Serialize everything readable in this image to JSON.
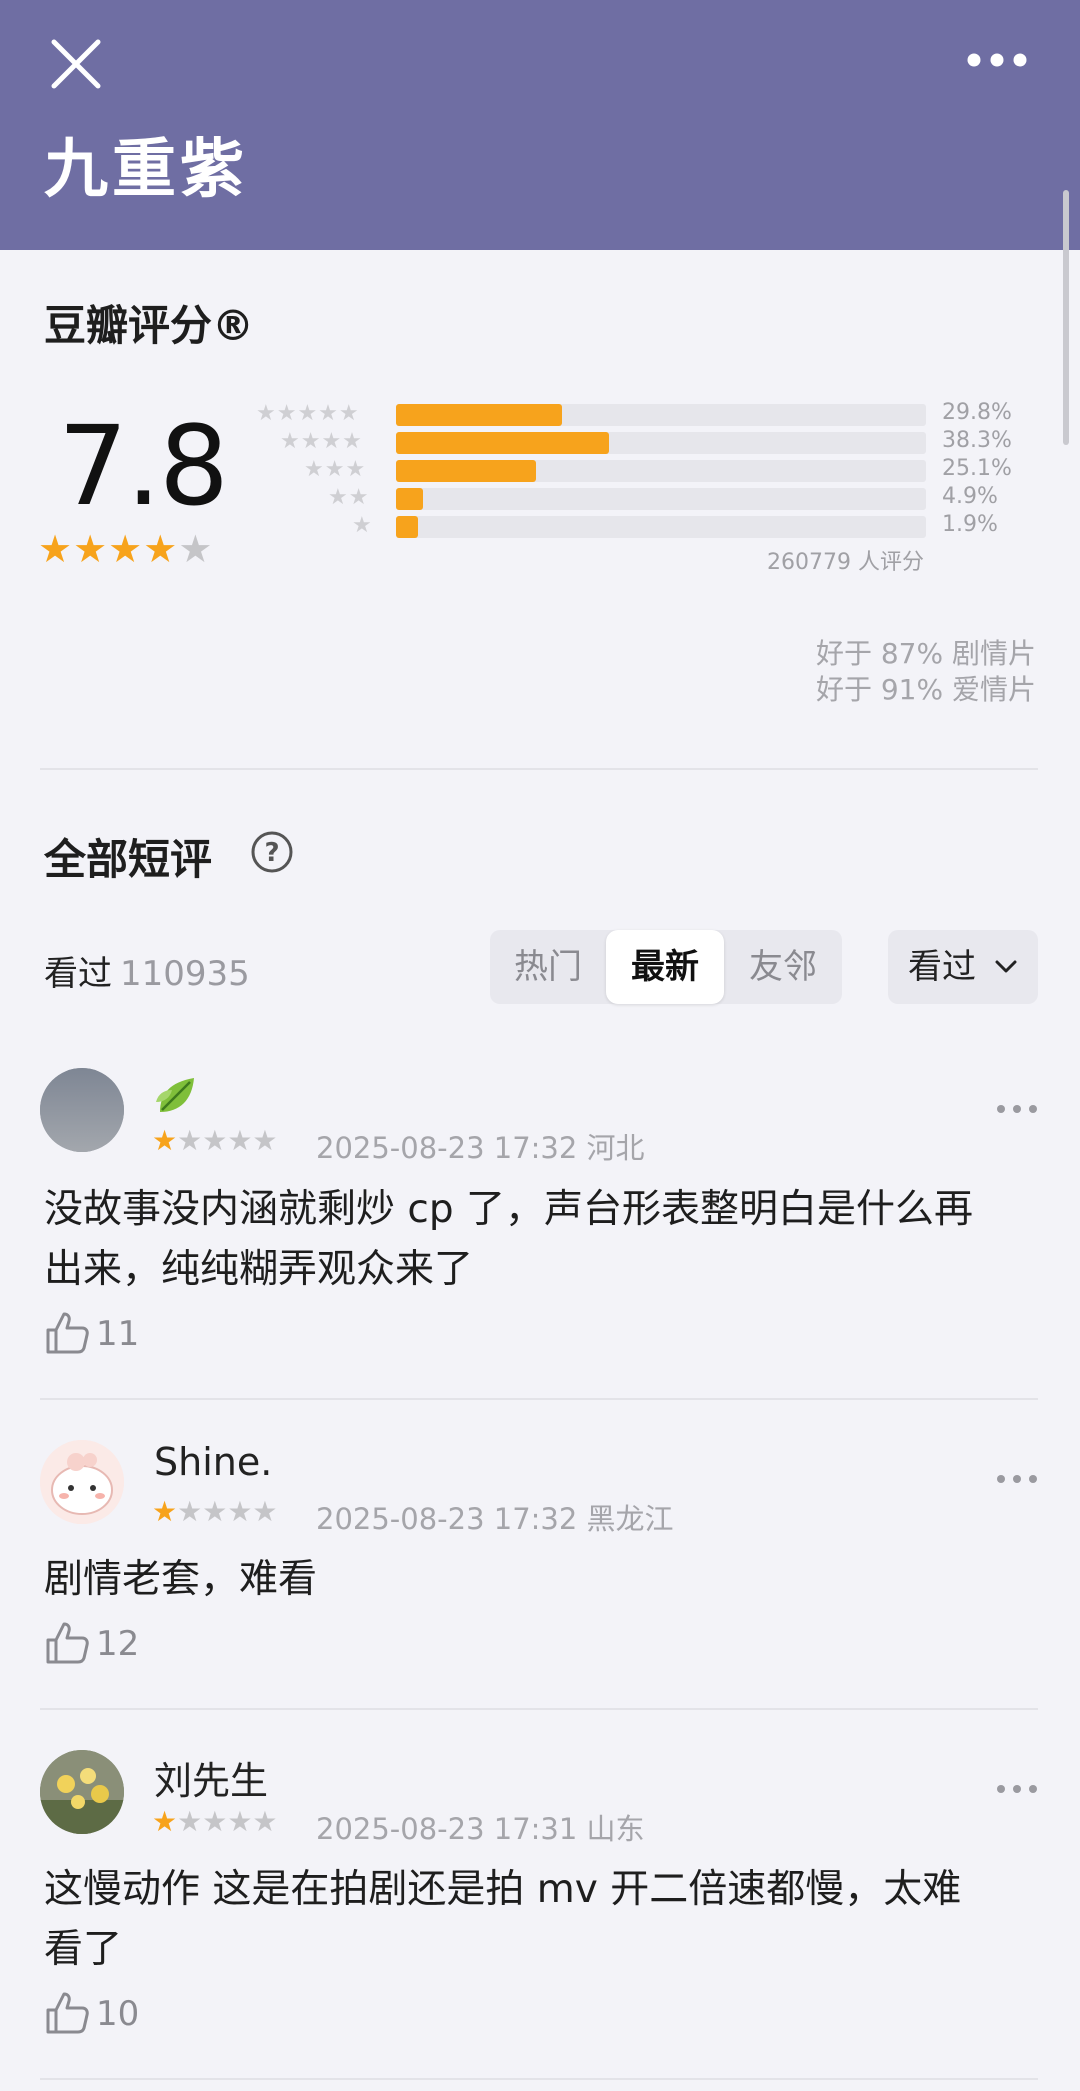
{
  "header": {
    "title": "九重紫",
    "close_icon": "close-icon",
    "more_icon": "more-icon",
    "bg_color": "#6f6ea3"
  },
  "rating": {
    "section_title": "豆瓣评分®",
    "score": "7.8",
    "stars": 4,
    "distribution": [
      {
        "stars": 5,
        "percent": 29.8,
        "label": "29.8%"
      },
      {
        "stars": 4,
        "percent": 38.3,
        "label": "38.3%"
      },
      {
        "stars": 3,
        "percent": 25.1,
        "label": "25.1%"
      },
      {
        "stars": 2,
        "percent": 4.9,
        "label": "4.9%"
      },
      {
        "stars": 1,
        "percent": 1.9,
        "label": "1.9%"
      }
    ],
    "count_text": "260779 人评分",
    "better_than": [
      "好于 87% 剧情片",
      "好于 91% 爱情片"
    ],
    "accent_color": "#f7a31c"
  },
  "comments_section": {
    "title": "全部短评",
    "help_icon": "help-icon",
    "seen_label": "看过",
    "seen_count": "110935",
    "tabs": [
      {
        "label": "热门",
        "active": false
      },
      {
        "label": "最新",
        "active": true
      },
      {
        "label": "友邻",
        "active": false
      }
    ],
    "filter_label": "看过",
    "filter_icon": "chevron-down-icon"
  },
  "comments": [
    {
      "username": "🍃",
      "stars": 1,
      "time": "2025-08-23 17:32",
      "location": "河北",
      "text_lines": [
        "没故事没内涵就剩炒 cp 了，声台形表整明白是什么再",
        "出来，纯纯糊弄观众来了"
      ],
      "likes": "11",
      "avatar": "avatar-grey"
    },
    {
      "username": "Shine.",
      "stars": 1,
      "time": "2025-08-23 17:32",
      "location": "黑龙江",
      "text_lines": [
        "剧情老套，难看"
      ],
      "likes": "12",
      "avatar": "avatar-cartoon"
    },
    {
      "username": "刘先生",
      "stars": 1,
      "time": "2025-08-23 17:31",
      "location": "山东",
      "text_lines": [
        "这慢动作 这是在拍剧还是拍 mv 开二倍速都慢，太难",
        "看了"
      ],
      "likes": "10",
      "avatar": "avatar-flowers"
    }
  ]
}
